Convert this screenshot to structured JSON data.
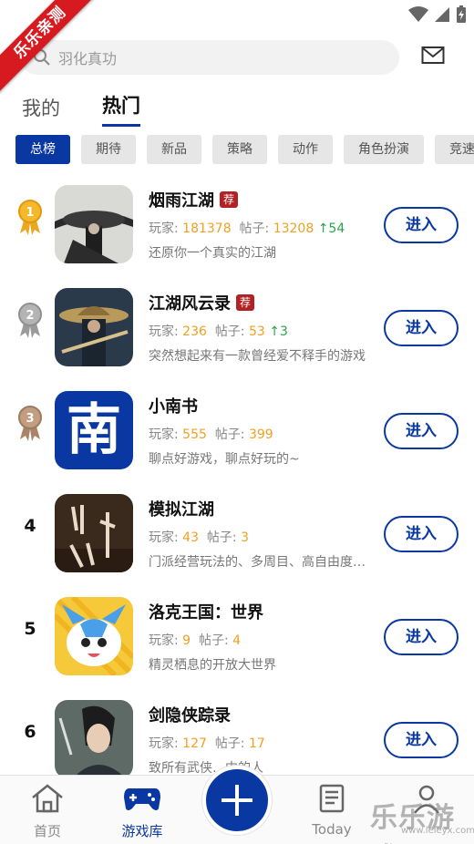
{
  "ribbon": "乐乐亲测",
  "search": {
    "placeholder": "羽化真功"
  },
  "top_tabs": [
    {
      "label": "我的",
      "active": false
    },
    {
      "label": "热门",
      "active": true
    }
  ],
  "chips": [
    {
      "label": "总榜",
      "active": true
    },
    {
      "label": "期待",
      "active": false
    },
    {
      "label": "新品",
      "active": false
    },
    {
      "label": "策略",
      "active": false
    },
    {
      "label": "动作",
      "active": false
    },
    {
      "label": "角色扮演",
      "active": false
    },
    {
      "label": "竞速",
      "active": false
    }
  ],
  "labels": {
    "players": "玩家: ",
    "posts": "帖子: ",
    "enter": "进入",
    "recommend": "荐"
  },
  "games": [
    {
      "rank": "1",
      "title": "烟雨江湖",
      "recommended": true,
      "players": "181378",
      "posts": "13208",
      "up": "↑54",
      "desc": "还原你一个真实的江湖"
    },
    {
      "rank": "2",
      "title": "江湖风云录",
      "recommended": true,
      "players": "236",
      "posts": "53",
      "up": "↑3",
      "desc": "突然想起来有一款曾经爱不释手的游戏"
    },
    {
      "rank": "3",
      "title": "小南书",
      "recommended": false,
      "players": "555",
      "posts": "399",
      "up": "",
      "desc": "聊点好游戏，聊点好玩的~",
      "icon_text": "南"
    },
    {
      "rank": "4",
      "title": "模拟江湖",
      "recommended": false,
      "players": "43",
      "posts": "3",
      "up": "",
      "desc": "门派经营玩法的、多周目、高自由度武侠"
    },
    {
      "rank": "5",
      "title": "洛克王国：世界",
      "recommended": false,
      "players": "9",
      "posts": "4",
      "up": "",
      "desc": "精灵栖息的开放大世界"
    },
    {
      "rank": "6",
      "title": "剑隐侠踪录",
      "recommended": false,
      "players": "127",
      "posts": "17",
      "up": "",
      "desc": "致所有武侠…中的人"
    }
  ],
  "bottom_nav": [
    {
      "label": "首页",
      "icon": "home-icon",
      "active": false
    },
    {
      "label": "游戏库",
      "icon": "gamepad-icon",
      "active": true
    },
    {
      "label": "Today",
      "icon": "news-icon",
      "active": false
    },
    {
      "label": "",
      "icon": "user-icon",
      "active": false
    }
  ],
  "watermark": "乐乐游戏",
  "watermark_url": "www.leleyx.com",
  "colors": {
    "accent": "#0a38a3",
    "badge": "#b22222",
    "number": "#f0a020",
    "up": "#2aa34a",
    "ribbon": "#d71a20"
  }
}
